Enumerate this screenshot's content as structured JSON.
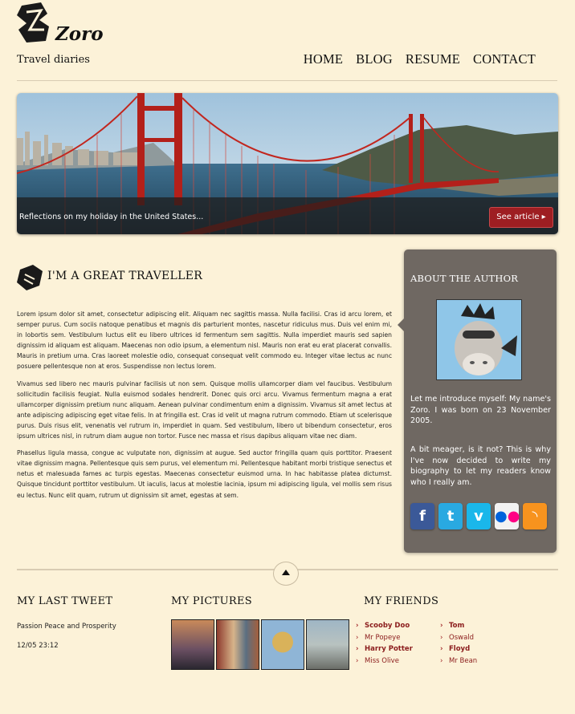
{
  "header": {
    "logo_text": "Zoro",
    "tagline": "Travel diaries",
    "nav": [
      "HOME",
      "BLOG",
      "RESUME",
      "CONTACT"
    ]
  },
  "hero": {
    "caption": "Reflections on my holiday in the United States...",
    "button_label": "See article ▸"
  },
  "article": {
    "title": "I'M A GREAT TRAVELLER",
    "paragraphs": [
      "Lorem ipsum dolor sit amet, consectetur adipiscing elit. Aliquam nec sagittis massa. Nulla facilisi. Cras id arcu lorem, et semper purus. Cum sociis natoque penatibus et magnis dis parturient montes, nascetur ridiculus mus. Duis vel enim mi, in lobortis sem. Vestibulum luctus elit eu libero ultrices id fermentum sem sagittis. Nulla imperdiet mauris sed sapien dignissim id aliquam est aliquam. Maecenas non odio ipsum, a elementum nisl. Mauris non erat eu erat placerat convallis. Mauris in pretium urna. Cras laoreet molestie odio, consequat consequat velit commodo eu. Integer vitae lectus ac nunc posuere pellentesque non at eros. Suspendisse non lectus lorem.",
      "Vivamus sed libero nec mauris pulvinar facilisis ut non sem. Quisque mollis ullamcorper diam vel faucibus. Vestibulum sollicitudin facilisis feugiat. Nulla euismod sodales hendrerit. Donec quis orci arcu. Vivamus fermentum magna a erat ullamcorper dignissim pretium nunc aliquam. Aenean pulvinar condimentum enim a dignissim. Vivamus sit amet lectus at ante adipiscing adipiscing eget vitae felis. In at fringilla est. Cras id velit ut magna rutrum commodo. Etiam ut scelerisque purus. Duis risus elit, venenatis vel rutrum in, imperdiet in quam. Sed vestibulum, libero ut bibendum consectetur, eros ipsum ultrices nisl, in rutrum diam augue non tortor. Fusce nec massa et risus dapibus aliquam vitae nec diam.",
      "Phasellus ligula massa, congue ac vulputate non, dignissim at augue. Sed auctor fringilla quam quis porttitor. Praesent vitae dignissim magna. Pellentesque quis sem purus, vel elementum mi. Pellentesque habitant morbi tristique senectus et netus et malesuada fames ac turpis egestas. Maecenas consectetur euismod urna. In hac habitasse platea dictumst. Quisque tincidunt porttitor vestibulum. Ut iaculis, lacus at molestie lacinia, ipsum mi adipiscing ligula, vel mollis sem risus eu lectus. Nunc elit quam, rutrum ut dignissim sit amet, egestas at sem."
    ]
  },
  "about": {
    "title": "ABOUT THE AUTHOR",
    "intro": "Let me introduce myself: My name's Zoro. I was born on 23 November 2005.",
    "more": "A bit meager, is it not? This is why I've now decided to write my biography to let my readers know who I really am.",
    "social": [
      {
        "icon": "facebook-icon",
        "glyph": "f",
        "color": "#3b5998"
      },
      {
        "icon": "twitter-icon",
        "glyph": "t",
        "color": "#29a9e1"
      },
      {
        "icon": "vimeo-icon",
        "glyph": "v",
        "color": "#1ab7ea"
      },
      {
        "icon": "flickr-icon",
        "glyph": "••",
        "color": "#f2f2f2"
      },
      {
        "icon": "rss-icon",
        "glyph": "◝",
        "color": "#f7931e"
      }
    ]
  },
  "tweet": {
    "title": "MY LAST TWEET",
    "text": "Passion Peace and Prosperity",
    "time": "12/05 23:12"
  },
  "pictures": {
    "title": "MY PICTURES"
  },
  "friends": {
    "title": "MY FRIENDS",
    "col1": [
      "Scooby Doo",
      "Mr Popeye",
      "Harry Potter",
      "Miss Olive"
    ],
    "col2": [
      "Tom",
      "Oswald",
      "Floyd",
      "Mr Bean"
    ]
  }
}
